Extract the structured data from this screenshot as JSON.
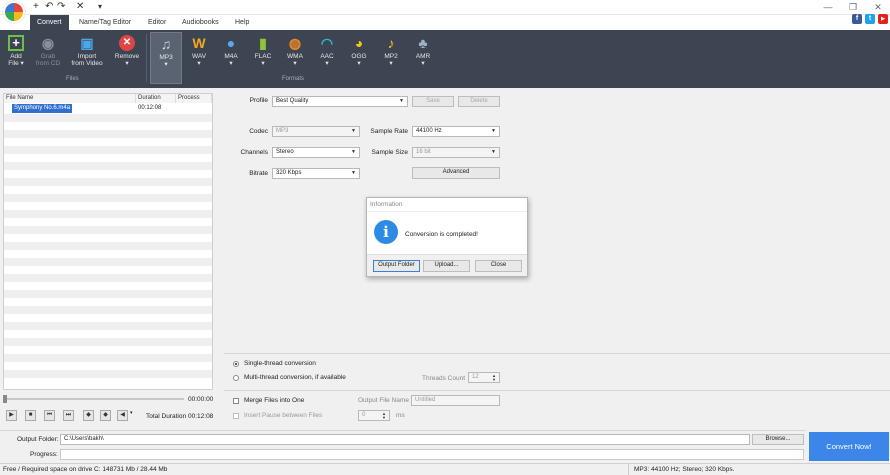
{
  "quick_access": {
    "new": "+",
    "undo": "↶",
    "redo": "↷",
    "close": "✕"
  },
  "window_controls": {
    "minimize": "—",
    "restore": "❐",
    "close": "✕"
  },
  "menu_tabs": [
    "Convert",
    "Name/Tag Editor",
    "Editor",
    "Audiobooks",
    "Help"
  ],
  "social": {
    "facebook": "f",
    "twitter": "t",
    "youtube": "▶"
  },
  "ribbon": {
    "files": {
      "group_label": "Files",
      "items": [
        {
          "label1": "Add",
          "label2": "File ▾",
          "icon": "add-file-icon"
        },
        {
          "label1": "Grab",
          "label2": "from CD",
          "icon": "cd-icon"
        },
        {
          "label1": "Import",
          "label2": "from Video",
          "icon": "import-video-icon"
        },
        {
          "label1": "Remove",
          "label2": "▾",
          "icon": "remove-icon"
        }
      ]
    },
    "formats": {
      "group_label": "Formats",
      "items": [
        {
          "label1": "MP3",
          "label2": "▾",
          "icon": "mp3-icon",
          "color": "#cfd3da"
        },
        {
          "label1": "WAV",
          "label2": "▾",
          "icon": "wav-icon",
          "color": "#f5a623"
        },
        {
          "label1": "M4A",
          "label2": "▾",
          "icon": "apple-icon",
          "color": "#5aa9f0"
        },
        {
          "label1": "FLAC",
          "label2": "▾",
          "icon": "flac-icon",
          "color": "#8fc43b"
        },
        {
          "label1": "WMA",
          "label2": "▾",
          "icon": "wma-icon",
          "color": "#f08a24"
        },
        {
          "label1": "AAC",
          "label2": "▾",
          "icon": "aac-icon",
          "color": "#2bbbd8"
        },
        {
          "label1": "OGG",
          "label2": "▾",
          "icon": "ogg-icon",
          "color": "#f5c51a"
        },
        {
          "label1": "MP2",
          "label2": "▾",
          "icon": "mp2-icon",
          "color": "#f5c51a"
        },
        {
          "label1": "AMR",
          "label2": "▾",
          "icon": "amr-icon",
          "color": "#9fb2c8"
        }
      ]
    }
  },
  "file_list": {
    "columns": [
      "File Name",
      "Duration",
      "Process"
    ],
    "rows": [
      {
        "name": "Symphony No.6.m4a",
        "duration": "00:12:08",
        "process": ""
      }
    ]
  },
  "player": {
    "time": "00:00:00",
    "total_label": "Total Duration",
    "total": "00:12:08"
  },
  "settings": {
    "profile_label": "Profile",
    "profile_value": "Best Quality",
    "save": "Save",
    "delete": "Delete",
    "codec_label": "Codec",
    "codec_value": "MP3",
    "channels_label": "Channels",
    "channels_value": "Stereo",
    "bitrate_label": "Bitrate",
    "bitrate_value": "320 Kbps",
    "sample_rate_label": "Sample Rate",
    "sample_rate_value": "44100 Hz",
    "sample_size_label": "Sample Size",
    "sample_size_value": "16 bit",
    "advanced": "Advanced"
  },
  "dialog": {
    "title": "Information",
    "message": "Conversion is completed!",
    "buttons": [
      "Output Folder",
      "Upload...",
      "Close"
    ]
  },
  "threads": {
    "single": "Single-thread conversion",
    "multi": "Multi-thread conversion, if available",
    "count_label": "Threads Count",
    "count_value": "12"
  },
  "merge": {
    "label": "Merge Files into One",
    "pause_label": "Insert Pause between Files",
    "output_name_label": "Output File Name",
    "output_name_value": "Untitled",
    "pause_value": "0",
    "pause_unit": "ms"
  },
  "output": {
    "folder_label": "Output Folder:",
    "folder_value": "C:\\Users\\bakh\\",
    "browse": "Browse...",
    "progress_label": "Progress:"
  },
  "convert_button": "Convert Now!",
  "status": {
    "left": "Free / Required space on drive  C: 148731 Mb / 28.44 Mb",
    "right": "MP3: 44100  Hz; Stereo; 320 Kbps."
  }
}
